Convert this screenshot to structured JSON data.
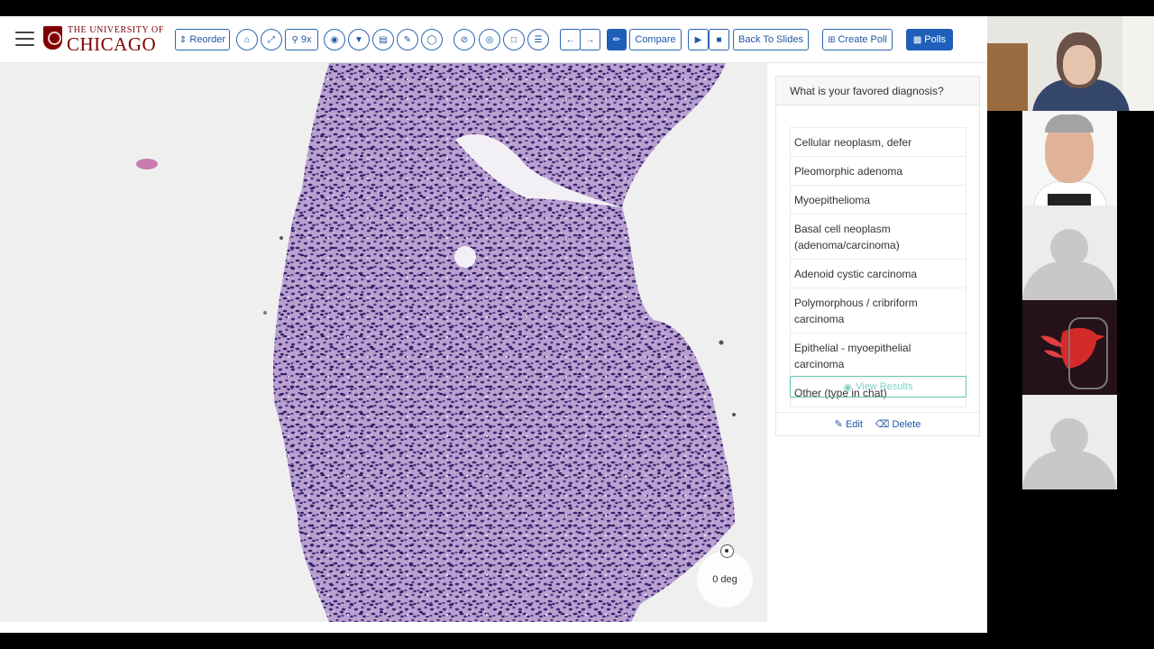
{
  "logo": {
    "line1": "THE UNIVERSITY OF",
    "line2": "CHICAGO"
  },
  "toolbar": {
    "reorder": "Reorder",
    "zoom": "9x",
    "compare": "Compare",
    "back_to_slides": "Back To Slides",
    "create_poll": "Create Poll",
    "polls": "Polls",
    "brand_color": "#1f5fb8"
  },
  "viewer": {
    "rotation": "0 deg"
  },
  "poll": {
    "question": "What is your favored diagnosis?",
    "options": [
      "Cellular neoplasm, defer",
      "Pleomorphic adenoma",
      "Myoepithelioma",
      "Basal cell neoplasm (adenoma/carcinoma)",
      "Adenoid cystic carcinoma",
      "Polymorphous / cribriform carcinoma",
      "Epithelial - myoepithelial carcinoma",
      "Other (type in chat)"
    ],
    "view_results": "View Results",
    "edit": "Edit",
    "delete": "Delete",
    "accent_color": "#5cc4b4"
  },
  "icons": [
    "menu-icon",
    "sort-icon",
    "home-icon",
    "expand-icon",
    "zoom-icon",
    "camera-icon",
    "filter-icon",
    "monitor-icon",
    "pencil-icon",
    "lasso-icon",
    "measure-icon",
    "circle-target-icon",
    "square-icon",
    "list-icon",
    "arrow-left-icon",
    "arrow-right-icon",
    "pin-icon",
    "video-icon",
    "stop-icon",
    "plus-square-icon",
    "bar-chart-icon",
    "eye-icon",
    "edit-icon",
    "trash-icon"
  ]
}
